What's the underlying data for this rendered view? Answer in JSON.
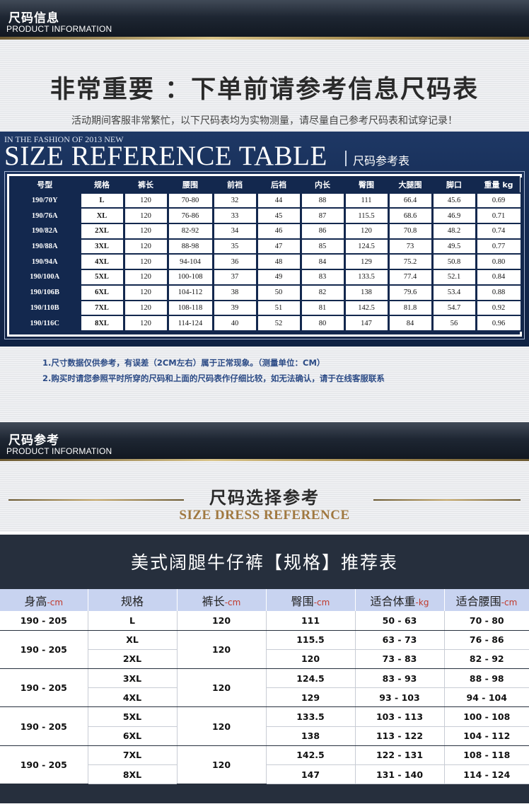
{
  "section1": {
    "header_cn": "尺码信息",
    "header_en": "PRODUCT INFORMATION",
    "headline": "非常重要 ：下单前请参考信息尺码表",
    "subline": "活动期间客服非常繁忙，以下尺码表均为实物测量，请尽量自己参考尺码表和试穿记录！",
    "banner_small": "IN THE FASHION OF 2013 NEW",
    "banner_big": "SIZE REFERENCE TABLE",
    "banner_cn": "尺码参考表",
    "size_table": {
      "headers": [
        "号型",
        "规格",
        "裤长",
        "腰围",
        "前裆",
        "后裆",
        "内长",
        "臀围",
        "大腿围",
        "脚口",
        "重量 kg"
      ],
      "rows": [
        [
          "190/70Y",
          "L",
          "120",
          "70-80",
          "32",
          "44",
          "88",
          "111",
          "66.4",
          "45.6",
          "0.69"
        ],
        [
          "190/76A",
          "XL",
          "120",
          "76-86",
          "33",
          "45",
          "87",
          "115.5",
          "68.6",
          "46.9",
          "0.71"
        ],
        [
          "190/82A",
          "2XL",
          "120",
          "82-92",
          "34",
          "46",
          "86",
          "120",
          "70.8",
          "48.2",
          "0.74"
        ],
        [
          "190/88A",
          "3XL",
          "120",
          "88-98",
          "35",
          "47",
          "85",
          "124.5",
          "73",
          "49.5",
          "0.77"
        ],
        [
          "190/94A",
          "4XL",
          "120",
          "94-104",
          "36",
          "48",
          "84",
          "129",
          "75.2",
          "50.8",
          "0.80"
        ],
        [
          "190/100A",
          "5XL",
          "120",
          "100-108",
          "37",
          "49",
          "83",
          "133.5",
          "77.4",
          "52.1",
          "0.84"
        ],
        [
          "190/106B",
          "6XL",
          "120",
          "104-112",
          "38",
          "50",
          "82",
          "138",
          "79.6",
          "53.4",
          "0.88"
        ],
        [
          "190/110B",
          "7XL",
          "120",
          "108-118",
          "39",
          "51",
          "81",
          "142.5",
          "81.8",
          "54.7",
          "0.92"
        ],
        [
          "190/116C",
          "8XL",
          "120",
          "114-124",
          "40",
          "52",
          "80",
          "147",
          "84",
          "56",
          "0.96"
        ]
      ]
    },
    "notes": [
      "1.尺寸数据仅供参考，有误差（2CM左右）属于正常现象。（测量单位：CM）",
      "2.购买时请您参照平时所穿的尺码和上面的尺码表作仔细比较，如无法确认，请于在线客服联系"
    ]
  },
  "section2": {
    "header_cn": "尺码参考",
    "header_en": "PRODUCT INFORMATION",
    "ref_cn": "尺码选择参考",
    "ref_en": "SIZE DRESS REFERENCE",
    "panel_title": "美式阔腿牛仔裤【规格】推荐表",
    "rec_table": {
      "headers": [
        {
          "label": "身高",
          "unit": "-cm"
        },
        {
          "label": "规格",
          "unit": ""
        },
        {
          "label": "裤长",
          "unit": "-cm"
        },
        {
          "label": "臀围",
          "unit": "-cm"
        },
        {
          "label": "适合体重",
          "unit": "-kg"
        },
        {
          "label": "适合腰围",
          "unit": "-cm"
        }
      ],
      "groups": [
        {
          "height": "190 - 205",
          "length": "120",
          "rows": [
            {
              "size": "L",
              "hip": "111",
              "weight": "50 - 63",
              "waist": "70 - 80"
            }
          ]
        },
        {
          "height": "190 - 205",
          "length": "120",
          "rows": [
            {
              "size": "XL",
              "hip": "115.5",
              "weight": "63 - 73",
              "waist": "76 - 86"
            },
            {
              "size": "2XL",
              "hip": "120",
              "weight": "73 - 83",
              "waist": "82 - 92"
            }
          ]
        },
        {
          "height": "190 - 205",
          "length": "120",
          "rows": [
            {
              "size": "3XL",
              "hip": "124.5",
              "weight": "83 - 93",
              "waist": "88 - 98"
            },
            {
              "size": "4XL",
              "hip": "129",
              "weight": "93 - 103",
              "waist": "94 - 104"
            }
          ]
        },
        {
          "height": "190 - 205",
          "length": "120",
          "rows": [
            {
              "size": "5XL",
              "hip": "133.5",
              "weight": "103 - 113",
              "waist": "100 - 108"
            },
            {
              "size": "6XL",
              "hip": "138",
              "weight": "113 - 122",
              "waist": "104 - 112"
            }
          ]
        },
        {
          "height": "190 - 205",
          "length": "120",
          "rows": [
            {
              "size": "7XL",
              "hip": "142.5",
              "weight": "122 - 131",
              "waist": "108 - 118"
            },
            {
              "size": "8XL",
              "hip": "147",
              "weight": "131 - 140",
              "waist": "114 - 124"
            }
          ]
        }
      ]
    }
  },
  "colors": {
    "navy": "#13284e",
    "header_dark": "#1c2430",
    "gold": "#c8a968",
    "note_blue": "#2c4b86",
    "unit_red": "#c0392b",
    "rec_header_bg": "#c8d3f0"
  }
}
